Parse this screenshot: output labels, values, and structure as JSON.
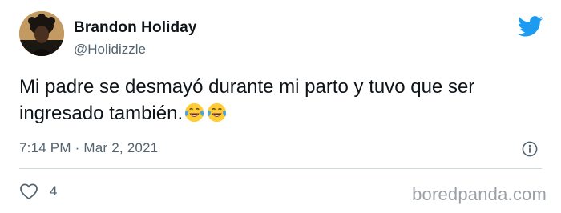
{
  "author": {
    "display_name": "Brandon Holiday",
    "handle": "@Holidizzle"
  },
  "tweet": {
    "text_line1": "Mi padre se desmayó durante mi parto y tuvo que ser",
    "text_line2": "ingresado también.",
    "emojis": [
      "face-with-tears-of-joy-icon",
      "face-with-tears-of-joy-icon"
    ],
    "timestamp": "7:14 PM · Mar 2, 2021"
  },
  "engagement": {
    "likes": "4"
  },
  "watermark": "boredpanda.com",
  "colors": {
    "twitter_blue": "#1d9bf0",
    "secondary_text": "#536471",
    "divider": "#cfd9de"
  }
}
